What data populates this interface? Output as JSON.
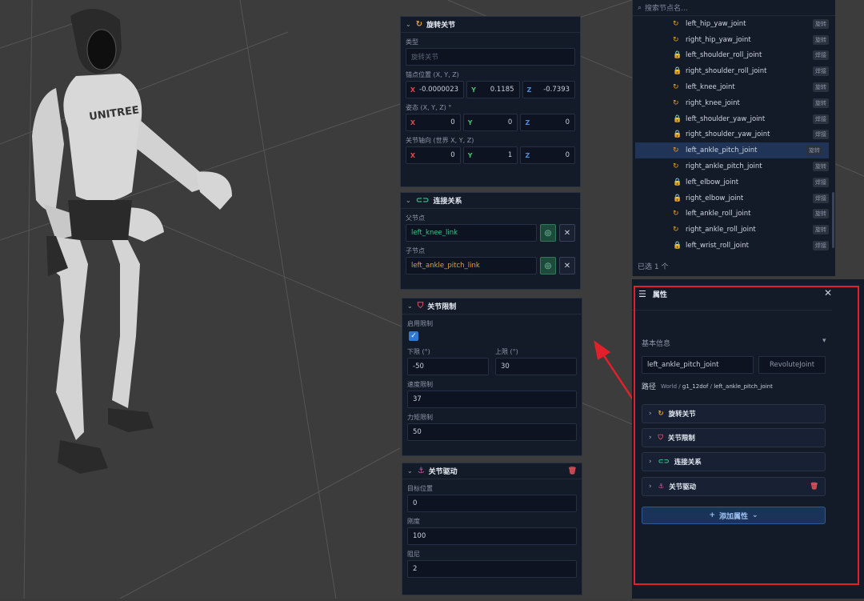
{
  "revolute_panel": {
    "title": "旋转关节",
    "type_label": "类型",
    "type_placeholder": "旋转关节",
    "anchor_label": "锚点位置 (X, Y, Z)",
    "anchor": {
      "x": "-0.0000023",
      "y": "0.1185",
      "z": "-0.7393"
    },
    "pose_label": "姿态 (X, Y, Z) °",
    "pose": {
      "x": "0",
      "y": "0",
      "z": "0"
    },
    "axis_label": "关节轴向 (世界 X, Y, Z)",
    "axis": {
      "x": "0",
      "y": "1",
      "z": "0"
    },
    "x": "X",
    "y": "Y",
    "z": "Z"
  },
  "connection_panel": {
    "title": "连接关系",
    "parent_label": "父节点",
    "parent_value": "left_knee_link",
    "child_label": "子节点",
    "child_value": "left_ankle_pitch_link",
    "close": "✕"
  },
  "limit_panel": {
    "title": "关节限制",
    "enable_label": "启用限制",
    "check": "✓",
    "lower_label": "下限 (°)",
    "lower": "-50",
    "upper_label": "上限 (°)",
    "upper": "30",
    "velocity_label": "速度限制",
    "velocity": "37",
    "torque_label": "力矩限制",
    "torque": "50"
  },
  "drive_panel": {
    "title": "关节驱动",
    "target_label": "目标位置",
    "target": "0",
    "stiffness_label": "刚度",
    "stiffness": "100",
    "damping_label": "阻尼",
    "damping": "2"
  },
  "tree": {
    "search_placeholder": "搜索节点名...",
    "selected_count": "已选 1 个",
    "items": [
      {
        "name": "left_hip_yaw_joint",
        "tag": "旋转",
        "icon": "rotate"
      },
      {
        "name": "right_hip_yaw_joint",
        "tag": "旋转",
        "icon": "rotate"
      },
      {
        "name": "left_shoulder_roll_joint",
        "tag": "焊接",
        "icon": "lock"
      },
      {
        "name": "right_shoulder_roll_joint",
        "tag": "焊接",
        "icon": "lock"
      },
      {
        "name": "left_knee_joint",
        "tag": "旋转",
        "icon": "rotate"
      },
      {
        "name": "right_knee_joint",
        "tag": "旋转",
        "icon": "rotate"
      },
      {
        "name": "left_shoulder_yaw_joint",
        "tag": "焊接",
        "icon": "lock"
      },
      {
        "name": "right_shoulder_yaw_joint",
        "tag": "焊接",
        "icon": "lock"
      },
      {
        "name": "left_ankle_pitch_joint",
        "tag": "旋转",
        "icon": "rotate",
        "selected": true
      },
      {
        "name": "right_ankle_pitch_joint",
        "tag": "旋转",
        "icon": "rotate"
      },
      {
        "name": "left_elbow_joint",
        "tag": "焊接",
        "icon": "lock"
      },
      {
        "name": "right_elbow_joint",
        "tag": "焊接",
        "icon": "lock"
      },
      {
        "name": "left_ankle_roll_joint",
        "tag": "旋转",
        "icon": "rotate"
      },
      {
        "name": "right_ankle_roll_joint",
        "tag": "旋转",
        "icon": "rotate"
      },
      {
        "name": "left_wrist_roll_joint",
        "tag": "焊接",
        "icon": "lock"
      }
    ]
  },
  "props": {
    "title": "属性",
    "basic_info": "基本信息",
    "name_value": "left_ankle_pitch_joint",
    "type_value": "RevoluteJoint",
    "path_label": "路径",
    "path_root": "World",
    "path_mid": "g1_12dof",
    "path_leaf": "left_ankle_pitch_joint",
    "sections": [
      "旋转关节",
      "关节限制",
      "连接关系",
      "关节驱动"
    ],
    "add_label": "添加属性"
  },
  "robot_brand": "UNITREE",
  "colors": {
    "accent": "#2e78d6",
    "highlight_box": "#e0202a",
    "rotate_icon": "#e8a030",
    "link_icon": "#3fc08a",
    "limit_icon": "#e05060",
    "drive_icon": "#d05aa8"
  }
}
